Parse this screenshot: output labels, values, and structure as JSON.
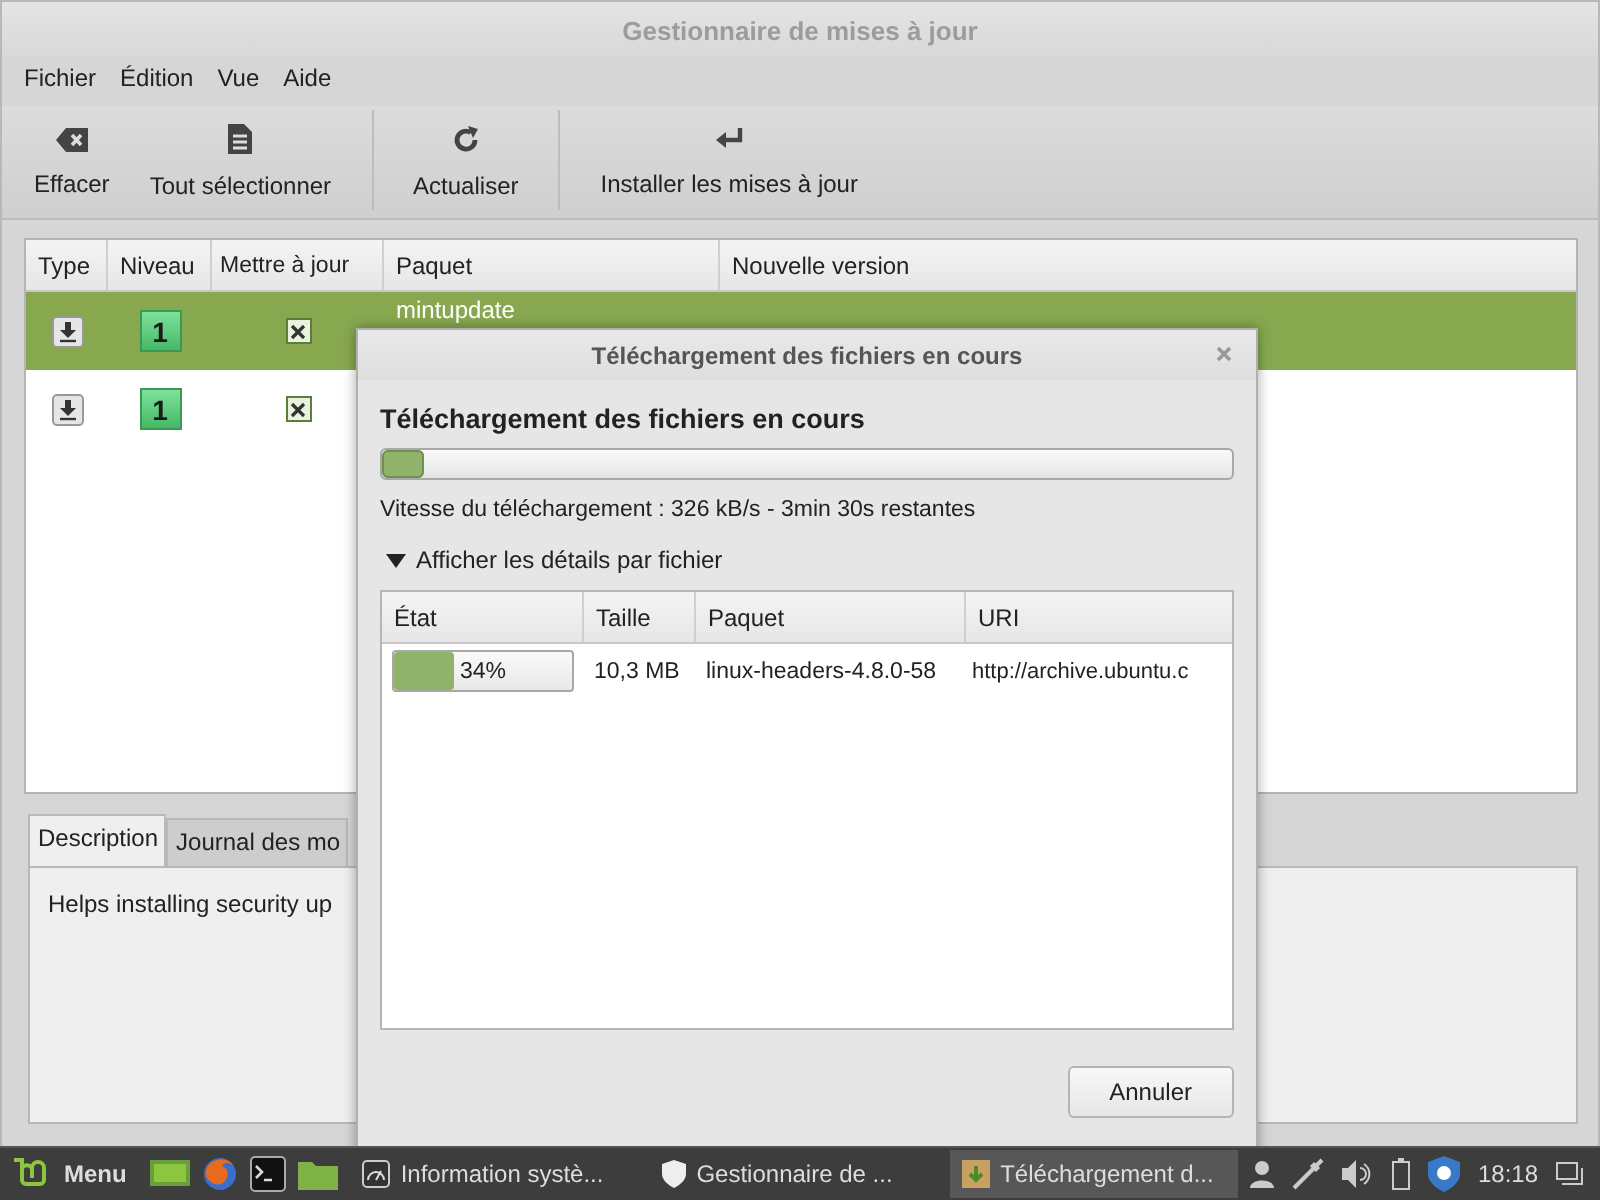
{
  "window": {
    "title": "Gestionnaire de mises à jour"
  },
  "menu": [
    "Fichier",
    "Édition",
    "Vue",
    "Aide"
  ],
  "toolbar": [
    [
      {
        "label": "Effacer",
        "kind": "clear"
      },
      {
        "label": "Tout sélectionner",
        "kind": "select"
      }
    ],
    [
      {
        "label": "Actualiser",
        "kind": "refresh"
      }
    ],
    [
      {
        "label": "Installer les mises à jour",
        "kind": "install"
      }
    ]
  ],
  "table": {
    "columns": [
      "Type",
      "Niveau",
      "Mettre à jour",
      "Paquet",
      "Nouvelle version"
    ],
    "rows": [
      {
        "level": "1",
        "checked": true,
        "package": "mintupdate",
        "selected": true
      },
      {
        "level": "1",
        "checked": true,
        "selected": false
      }
    ]
  },
  "tabs": [
    {
      "label": "Description",
      "selected": true
    },
    {
      "label": "Journal des mo",
      "selected": false
    }
  ],
  "description": "Helps installing security up",
  "dialog": {
    "title": "Téléchargement des fichiers en cours",
    "heading": "Téléchargement des fichiers en cours",
    "progress": {
      "level": 0.05
    },
    "speed": "Vitesse du téléchargement : 326 kB/s - 3min 30s restantes",
    "expander": {
      "label": "Afficher les détails par fichier",
      "expanded": true
    },
    "table": {
      "columns": [
        "État",
        "Taille",
        "Paquet",
        "URI"
      ],
      "rows": [
        {
          "level": 0.34,
          "percent": "34%",
          "size": "10,3 MB",
          "package": "linux-headers-4.8.0-58",
          "uri": "http://archive.ubuntu.c"
        }
      ]
    },
    "button": "Annuler"
  },
  "taskbar": {
    "menu": "Menu",
    "windows": [
      {
        "label": "Information systè...",
        "kind": "sysinfo",
        "selected": false
      },
      {
        "label": "Gestionnaire de ...",
        "kind": "shield",
        "selected": false
      },
      {
        "label": "Téléchargement d...",
        "kind": "package",
        "selected": true
      }
    ],
    "clock": "18:18"
  }
}
